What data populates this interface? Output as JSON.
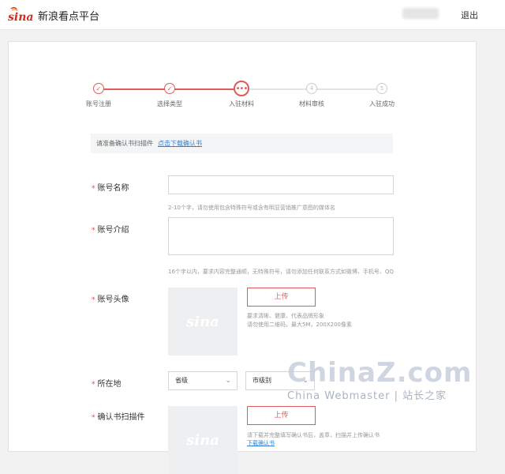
{
  "header": {
    "logo_text": "sina",
    "brand": "新浪看点平台",
    "logout": "退出"
  },
  "steps": [
    {
      "label": "账号注册",
      "state": "done"
    },
    {
      "label": "选择类型",
      "state": "done"
    },
    {
      "label": "入驻材料",
      "state": "active"
    },
    {
      "label": "材料审核",
      "state": "todo",
      "number": "4"
    },
    {
      "label": "入驻成功",
      "state": "todo",
      "number": "5"
    }
  ],
  "notice": {
    "text": "请准备确认书扫描件",
    "link": "点击下载确认书"
  },
  "form": {
    "name": {
      "label": "账号名称",
      "hint": "2-10个字，请勿使用包含特殊符号或含有明显营销推广意图的媒体名"
    },
    "intro": {
      "label": "账号介绍",
      "hint": "16个字以内，要求内容完整通顺，无特殊符号，请勿添加任何联系方式如微博、手机号、QQ"
    },
    "avatar": {
      "label": "账号头像",
      "upload": "上传",
      "hint1": "要求清晰、健康、代表品牌形象",
      "hint2": "请勿使用二维码，最大5M，200X200像素"
    },
    "location": {
      "label": "所在地",
      "province": "省级",
      "city": "市级别"
    },
    "confirm": {
      "label": "确认书扫描件",
      "upload": "上传",
      "hint": "请下载并完整填写确认书后，盖章，扫描并上传确认书",
      "link": "下载确认书"
    }
  },
  "watermark": {
    "big": "ChinaZ.com",
    "small": "China Webmaster | 站长之家"
  },
  "colors": {
    "accent": "#e05a5a",
    "link": "#2f7fd6"
  }
}
